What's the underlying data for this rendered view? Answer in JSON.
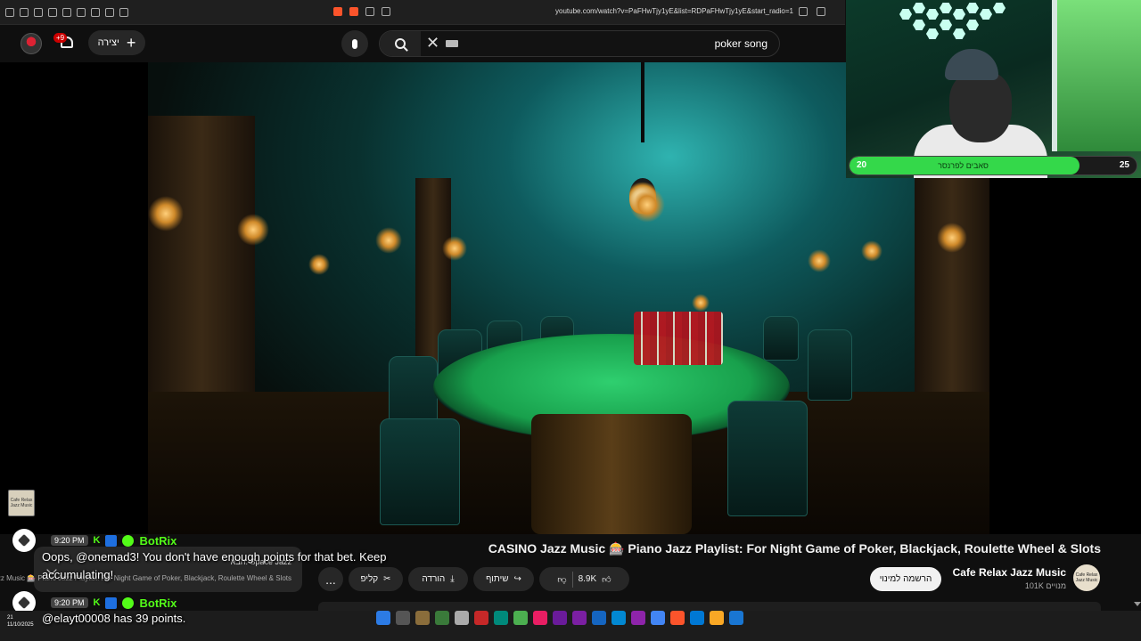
{
  "browser": {
    "url": "youtube.com/watch?v=PaFHwTjy1yE&list=RDPaFHwTjy1yE&start_radio=1"
  },
  "header": {
    "notification_count": "+9",
    "create_label": "יצירה",
    "search_query": "poker song"
  },
  "webcam": {
    "goal_title": "סאבים לפרנסר",
    "goal_current": "20",
    "goal_target": "25",
    "goal_progress": 0.8
  },
  "video": {
    "title": "CASINO Jazz Music 🎰 Piano Jazz Playlist: For Night Game of Poker, Blackjack, Roulette Wheel & Slots",
    "thumb_text": "Cafe Relax Jazz Music"
  },
  "channel": {
    "name": "Cafe Relax Jazz Music",
    "subscribers": "101K מנויים",
    "subscribe_label": "הרשמה למינוי",
    "avatar_text": "Cafe Relax Jazz Music"
  },
  "actions": {
    "likes": "8.9K",
    "share_label": "שיתוף",
    "download_label": "הורדה",
    "clip_label": "קליפ",
    "more_label": "..."
  },
  "up_next": {
    "label": "הבא: Space Jazz",
    "title": "מיקס – CASINO Jazz Music 🎰 Piano Jazz Playlist: For Night Game of Poker, Blackjack, Roulette Wheel & Slots"
  },
  "chat": [
    {
      "time": "9:20 PM",
      "user": "BotRix",
      "message": "Oops, @onemad3! You don't have enough points for that bet. Keep accumulating!"
    },
    {
      "time": "9:20 PM",
      "user": "BotRix",
      "message": "@elayt00008 has 39 points."
    }
  ],
  "taskbar": {
    "time": "21",
    "date": "11/10/2025"
  }
}
